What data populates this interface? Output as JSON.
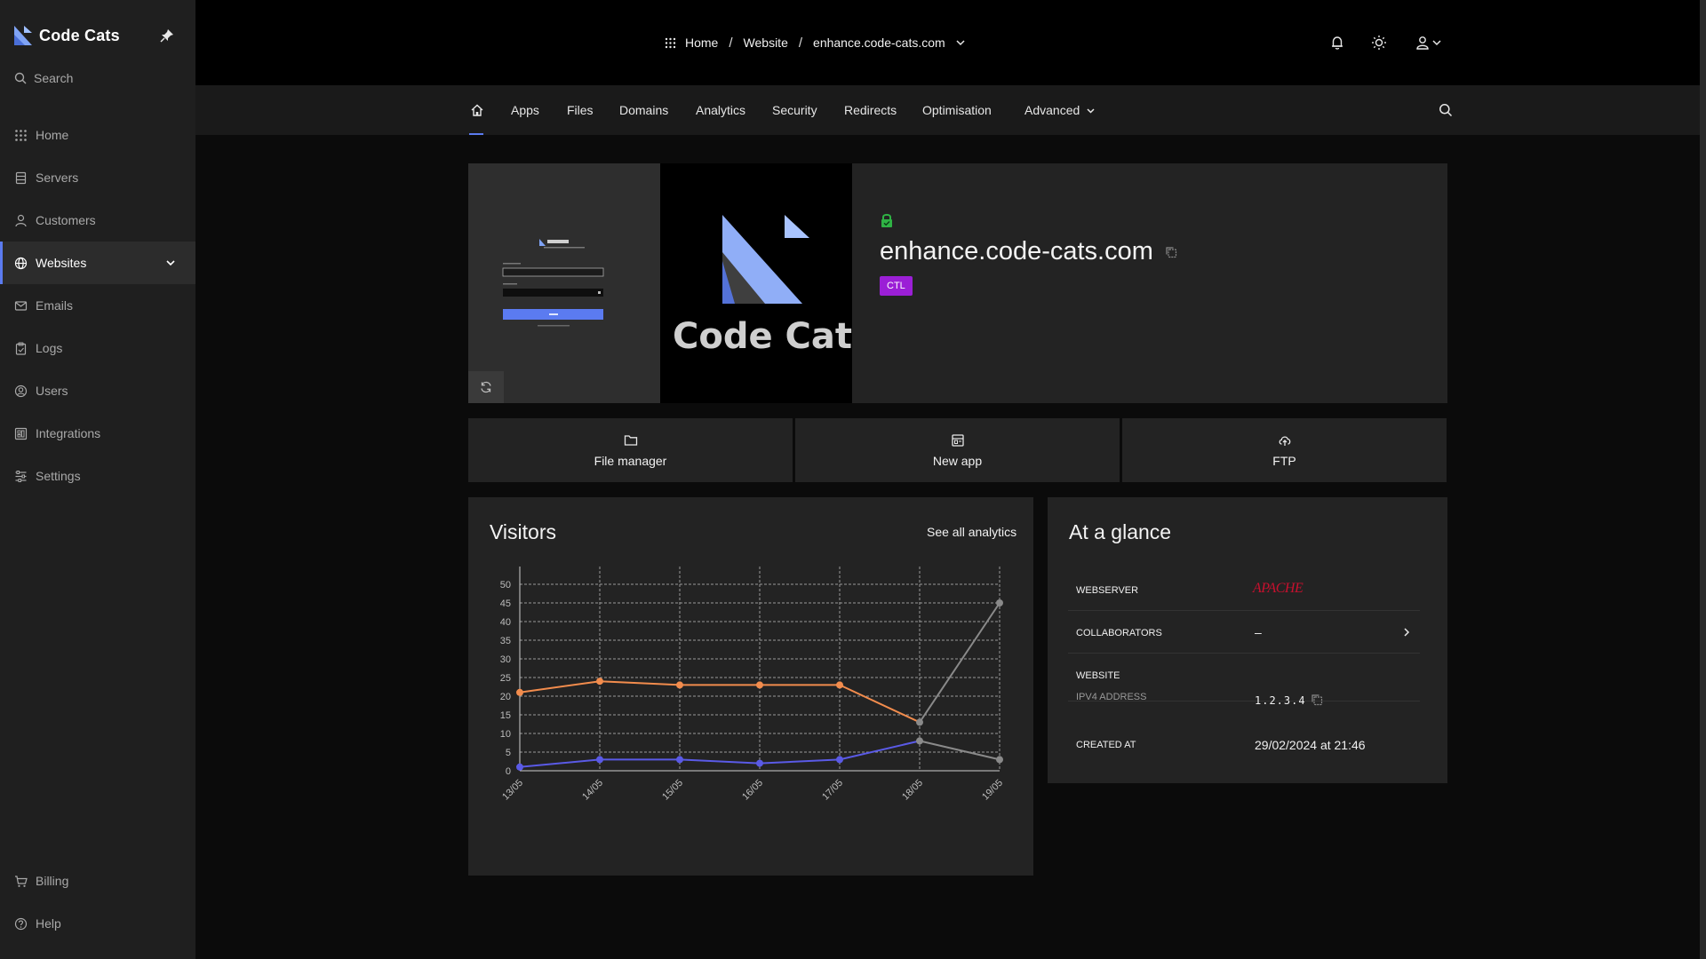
{
  "sidebar": {
    "brand": "Code Cats",
    "search_label": "Search",
    "items": [
      {
        "label": "Home"
      },
      {
        "label": "Servers"
      },
      {
        "label": "Customers"
      },
      {
        "label": "Websites"
      },
      {
        "label": "Emails"
      },
      {
        "label": "Logs"
      },
      {
        "label": "Users"
      },
      {
        "label": "Integrations"
      },
      {
        "label": "Settings"
      }
    ],
    "active_item": "Websites",
    "bottom_items": [
      {
        "label": "Billing"
      },
      {
        "label": "Help"
      }
    ]
  },
  "breadcrumb": {
    "home": "Home",
    "section": "Website",
    "current": "enhance.code-cats.com",
    "separator": "/"
  },
  "tabs": [
    {
      "label": "Apps"
    },
    {
      "label": "Files"
    },
    {
      "label": "Domains"
    },
    {
      "label": "Analytics"
    },
    {
      "label": "Security"
    },
    {
      "label": "Redirects"
    },
    {
      "label": "Optimisation"
    },
    {
      "label": "Advanced"
    }
  ],
  "hero": {
    "logo_text": "Code Cats",
    "site_name": "enhance.code-cats.com",
    "badge": "CTL",
    "ssl_status_color": "#2fb344"
  },
  "actions": [
    {
      "label": "File manager",
      "icon": "folder-icon"
    },
    {
      "label": "New app",
      "icon": "app-icon"
    },
    {
      "label": "FTP",
      "icon": "cloud-upload-icon"
    }
  ],
  "visitors": {
    "title": "Visitors",
    "link": "See all analytics"
  },
  "glance": {
    "title": "At a glance",
    "webserver_label": "WEBSERVER",
    "webserver_value": "APACHE",
    "collaborators_label": "COLLABORATORS",
    "collaborators_value": "–",
    "website_label": "WEBSITE",
    "ipv4_label": "IPV4 ADDRESS",
    "ipv4_value": "1.2.3.4",
    "created_label": "CREATED AT",
    "created_value": "29/02/2024 at 21:46"
  },
  "colors": {
    "accent": "#5b7bf0",
    "badge": "#9b1fd6",
    "series_orange": "#f28c4d",
    "series_blue": "#5a5ae6",
    "series_gray": "#8a8a8a"
  },
  "chart_data": {
    "type": "line",
    "title": "",
    "xlabel": "",
    "ylabel": "",
    "categories": [
      "13/05",
      "14/05",
      "15/05",
      "16/05",
      "17/05",
      "18/05",
      "19/05"
    ],
    "ylim": [
      0,
      50
    ],
    "yticks": [
      0,
      5,
      10,
      15,
      20,
      25,
      30,
      35,
      40,
      45,
      50
    ],
    "grid": true,
    "series": [
      {
        "values": [
          21,
          24,
          23,
          23,
          23,
          13,
          45
        ],
        "color": "#f28c4d",
        "gray_from_index": 5
      },
      {
        "values": [
          1,
          3,
          3,
          2,
          3,
          8,
          3
        ],
        "color": "#5a5ae6",
        "gray_from_index": 5
      }
    ]
  }
}
